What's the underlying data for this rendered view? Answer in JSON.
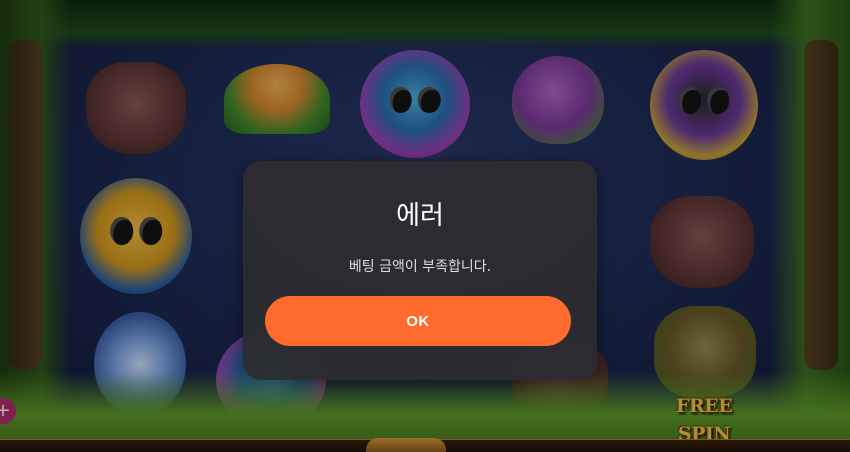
{
  "dialog": {
    "title": "에러",
    "message": "베팅 금액이 부족합니다.",
    "ok_label": "OK"
  },
  "game": {
    "free_spin_label": "FREE SPIN",
    "plus_label": "+"
  },
  "colors": {
    "accent": "#ff6a2d",
    "dialog_bg": "#2c2c30",
    "reel_bg": "#1b2750"
  }
}
